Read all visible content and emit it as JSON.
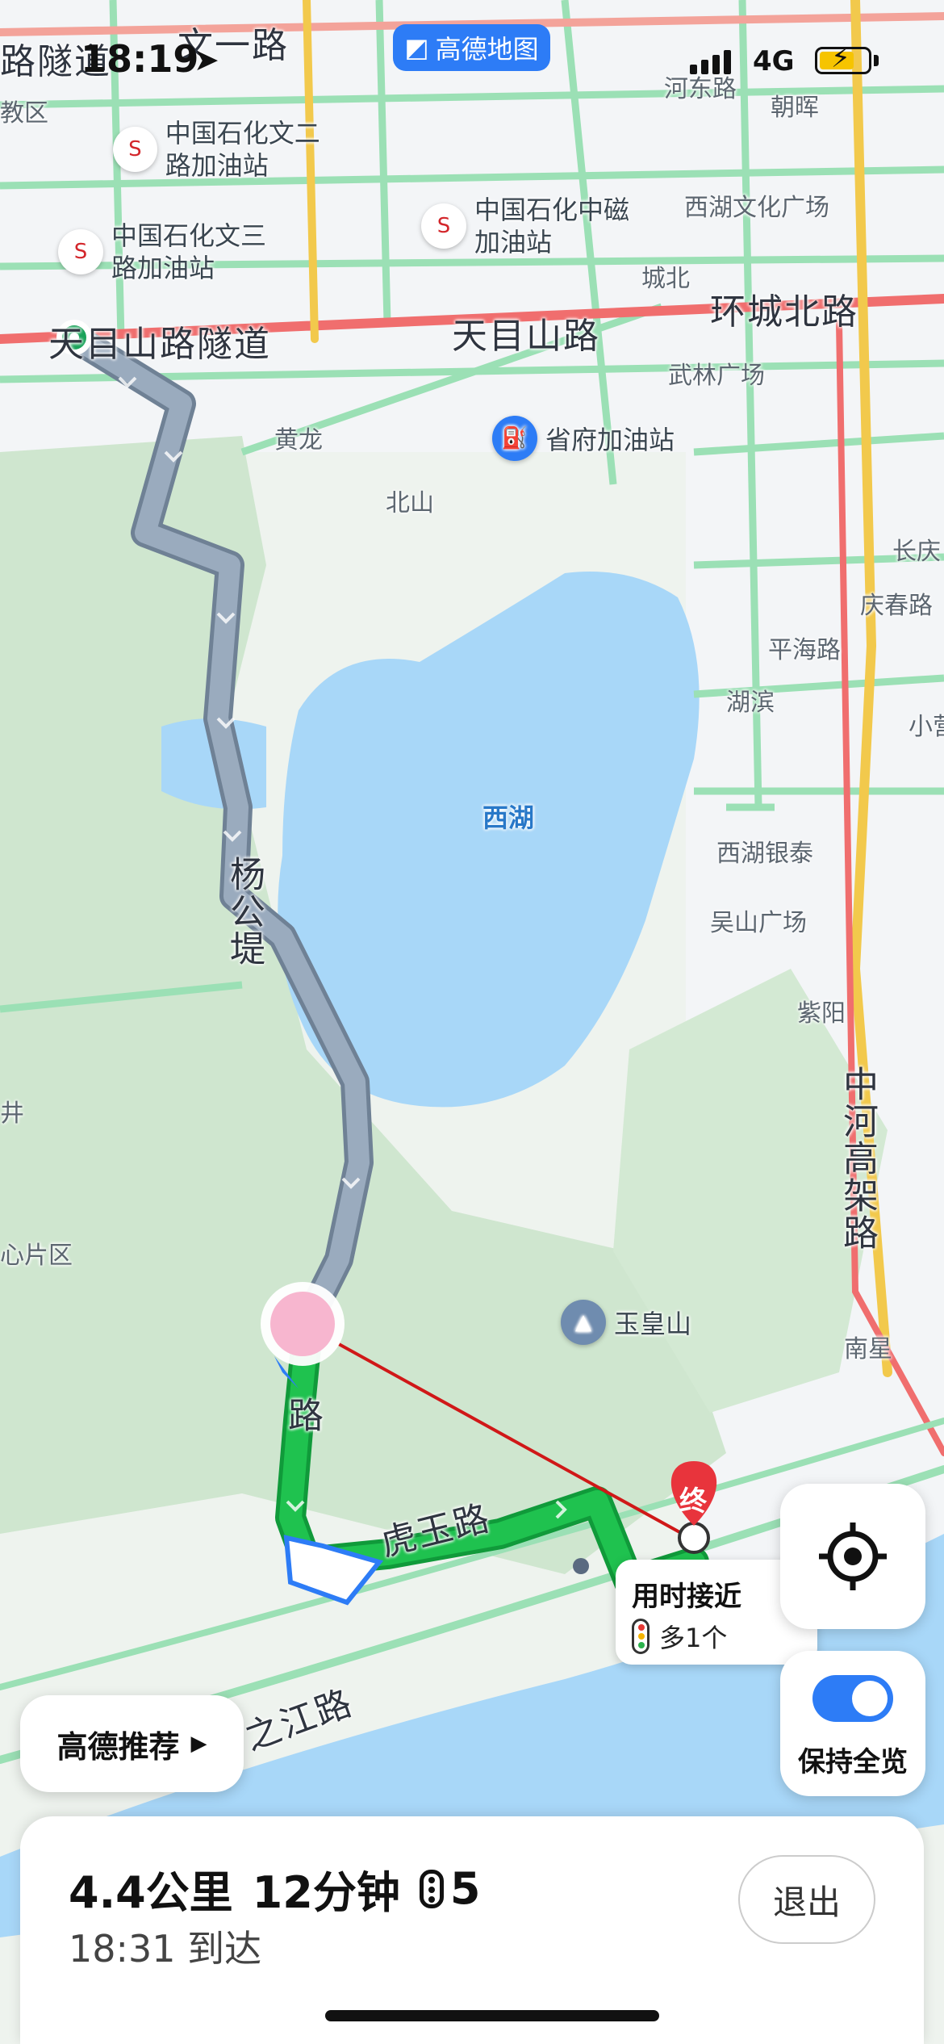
{
  "status_bar": {
    "time": "18:19",
    "app_badge": "高德地图",
    "network": "4G"
  },
  "map": {
    "roads": [
      "路隧道",
      "文一路",
      "天目山路隧道",
      "天目山路",
      "环城北路",
      "杨公堤",
      "虎玉路",
      "之江路",
      "中河高架路",
      "路"
    ],
    "areas": [
      "西湖",
      "教区",
      "黄龙",
      "北山",
      "城北",
      "武林广场",
      "河东路",
      "朝晖",
      "西湖文化广场",
      "长庆",
      "庆春路",
      "平海路",
      "湖滨",
      "小营",
      "西湖银泰",
      "吴山广场",
      "紫阳",
      "南星",
      "心片区",
      "井"
    ],
    "pois": {
      "gas1": "中国石化文二路加油站",
      "gas2": "中国石化文三路加油站",
      "gas3": "中国石化中磁加油站",
      "gas4": "省府加油站",
      "mountain": "玉皇山"
    },
    "destination_marker": "终"
  },
  "route_callout": {
    "title": "用时接近 ",
    "traffic_lights": "多1个"
  },
  "controls": {
    "overview_label": "保持全览",
    "recommend_label": "高德推荐"
  },
  "bottom_panel": {
    "distance": "4.4公里",
    "duration": "12分钟",
    "lights": "5",
    "arrival": "18:31 到达",
    "exit": "退出"
  },
  "colors": {
    "route_done": "#8a9bb0",
    "route_active": "#1fba4d",
    "accent": "#2d7cf6",
    "water": "#9cd3f7"
  }
}
